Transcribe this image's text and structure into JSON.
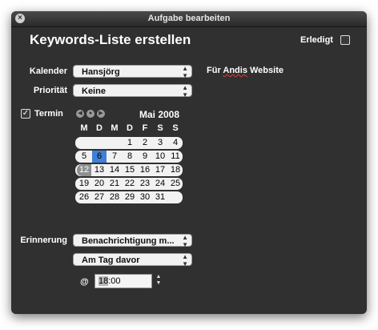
{
  "window": {
    "title": "Aufgabe bearbeiten"
  },
  "task": {
    "title": "Keywords-Liste erstellen",
    "done_label": "Erledigt"
  },
  "fields": {
    "calendar_label": "Kalender",
    "calendar_value": "Hansjörg",
    "priority_label": "Priorität",
    "priority_value": "Keine",
    "note_prefix": "Für ",
    "note_misspelled": "Andis",
    "note_suffix": " Website",
    "due_label": "Termin",
    "due_checked": true,
    "reminder_label": "Erinnerung",
    "reminder_type": "Benachrichtigung m...",
    "reminder_when": "Am Tag davor",
    "at_label": "@",
    "time_hour": "18",
    "time_rest": ":00"
  },
  "calendar": {
    "month_label": "Mai 2008",
    "weekdays": [
      "M",
      "D",
      "M",
      "D",
      "F",
      "S",
      "S"
    ],
    "weeks": [
      [
        "",
        "",
        "",
        "1",
        "2",
        "3",
        "4"
      ],
      [
        "5",
        "6",
        "7",
        "8",
        "9",
        "10",
        "11"
      ],
      [
        "12",
        "13",
        "14",
        "15",
        "16",
        "17",
        "18"
      ],
      [
        "19",
        "20",
        "21",
        "22",
        "23",
        "24",
        "25"
      ],
      [
        "26",
        "27",
        "28",
        "29",
        "30",
        "31",
        ""
      ]
    ],
    "selected_day": "6",
    "today": "12"
  },
  "icons": {
    "close": "close-icon",
    "nav_prev": "arrow-left-icon",
    "nav_today": "circle-icon",
    "nav_next": "arrow-right-icon",
    "popup_arrows": "updown-arrows-icon"
  }
}
